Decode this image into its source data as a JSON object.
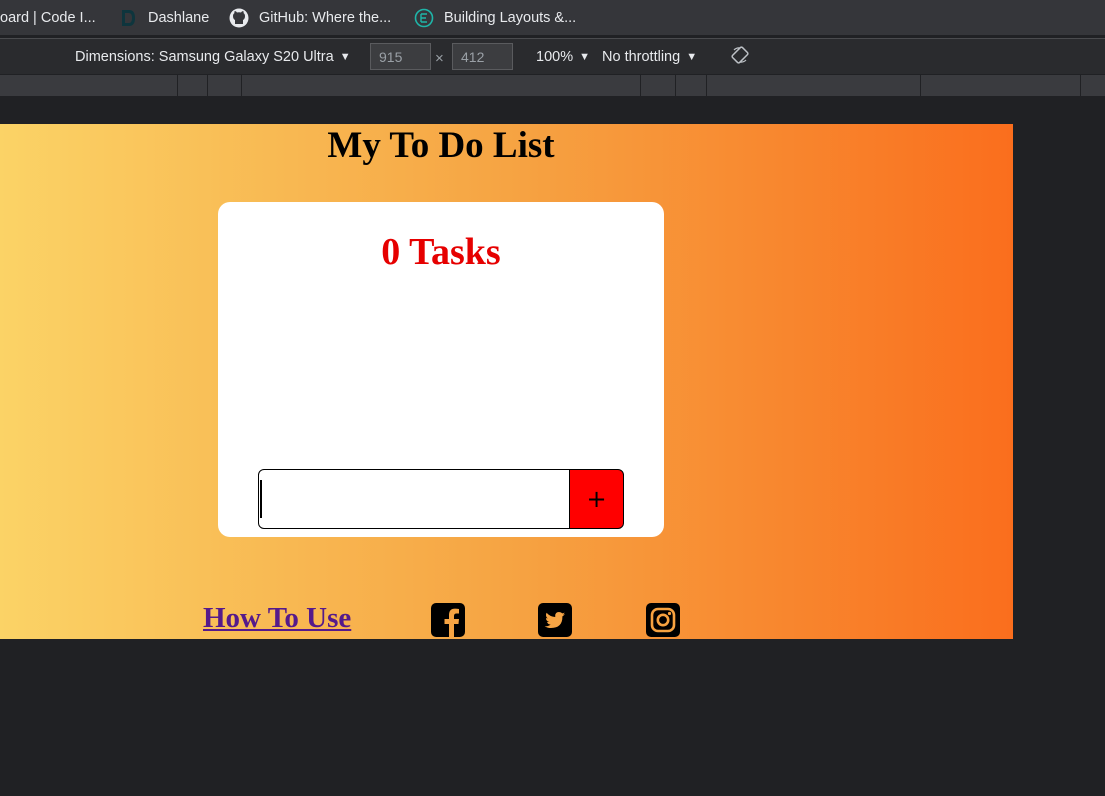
{
  "bookmarks": [
    {
      "label": "oard | Code I...",
      "icon": "none"
    },
    {
      "label": "Dashlane",
      "icon": "dashlane-icon"
    },
    {
      "label": "GitHub: Where the...",
      "icon": "github-icon"
    },
    {
      "label": "Building Layouts &...",
      "icon": "globe-icon"
    }
  ],
  "device_toolbar": {
    "dimensions_label": "Dimensions: Samsung Galaxy S20 Ultra",
    "width_value": "915",
    "times_symbol": "×",
    "height_value": "412",
    "zoom_label": "100%",
    "throttling_label": "No throttling",
    "dropdown_arrow": "▼"
  },
  "page": {
    "title": "My To Do List",
    "task_count": "0 Tasks",
    "input_value": "",
    "add_button_label": "+",
    "how_to_use_link": "How To Use",
    "social_icons": [
      "facebook-icon",
      "twitter-icon",
      "instagram-icon"
    ]
  },
  "colors": {
    "gradient_start": "#fbd366",
    "gradient_end": "#fa6e1d",
    "task_count_color": "#e60000",
    "add_button_bg": "#ff0000",
    "link_color": "#551a8b"
  }
}
